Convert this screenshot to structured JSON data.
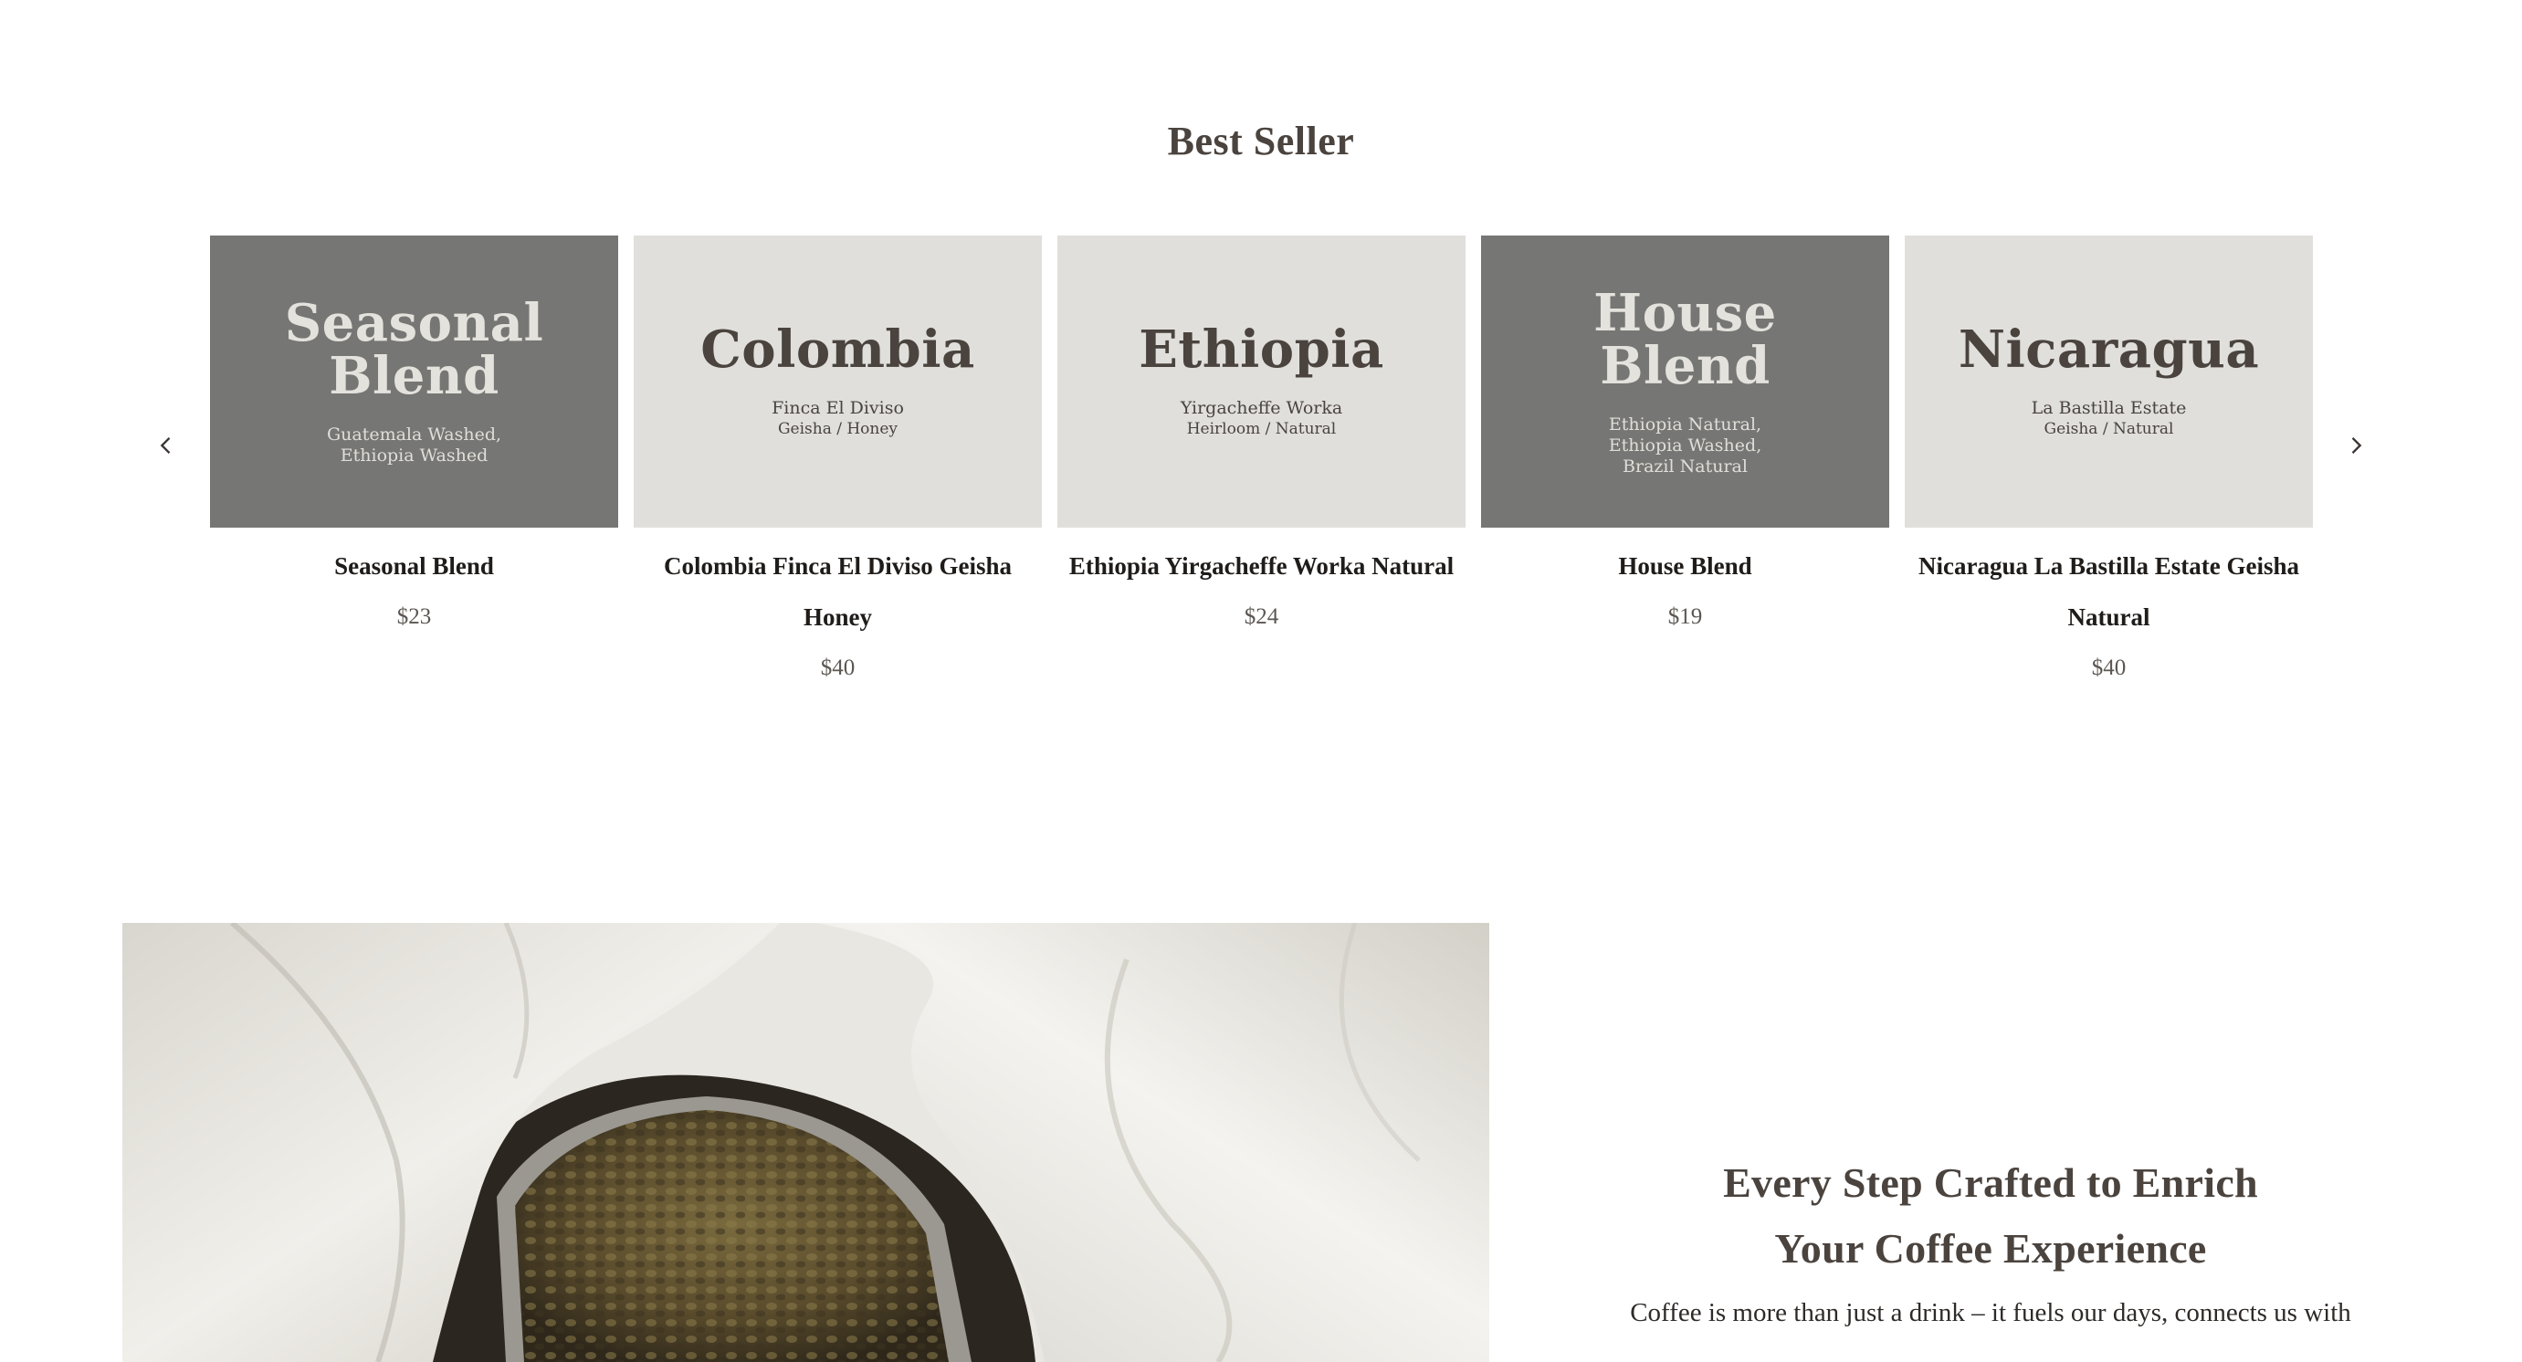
{
  "best_seller": {
    "title": "Best Seller",
    "prev_icon": "chevron-left-icon",
    "next_icon": "chevron-right-icon",
    "products": [
      {
        "art_title": "Seasonal\nBlend",
        "art_subtitle": "Guatemala Washed,\nEthiopia Washed",
        "art_detail": "",
        "theme": "dark",
        "name": "Seasonal Blend",
        "price": "$23"
      },
      {
        "art_title": "Colombia",
        "art_subtitle": "Finca El Diviso",
        "art_detail": "Geisha / Honey",
        "theme": "light",
        "name": "Colombia Finca El Diviso Geisha Honey",
        "price": "$40"
      },
      {
        "art_title": "Ethiopia",
        "art_subtitle": "Yirgacheffe Worka",
        "art_detail": "Heirloom / Natural",
        "theme": "light",
        "name": "Ethiopia Yirgacheffe Worka Natural",
        "price": "$24"
      },
      {
        "art_title": "House\nBlend",
        "art_subtitle": "Ethiopia Natural,\nEthiopia Washed,\nBrazil Natural",
        "art_detail": "",
        "theme": "dark",
        "name": "House Blend",
        "price": "$19"
      },
      {
        "art_title": "Nicaragua",
        "art_subtitle": "La Bastilla Estate",
        "art_detail": "Geisha / Natural",
        "theme": "light",
        "name": "Nicaragua La Bastilla Estate Geisha Natural",
        "price": "$40"
      }
    ]
  },
  "feature": {
    "image_name": "coffee-beans-in-bag-image",
    "heading": "Every Step Crafted to Enrich\nYour Coffee Experience",
    "body": "Coffee is more than just a drink – it fuels our days, connects us with"
  },
  "colors": {
    "card_dark": "#767674",
    "card_light": "#e0dfdb",
    "heading": "#4a433e"
  }
}
